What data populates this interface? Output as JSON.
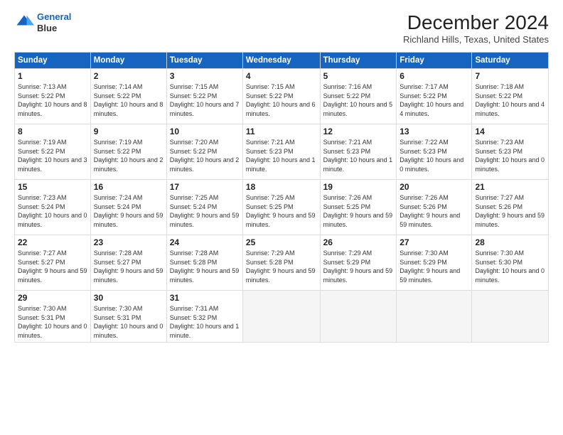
{
  "header": {
    "logo_line1": "General",
    "logo_line2": "Blue",
    "title": "December 2024",
    "subtitle": "Richland Hills, Texas, United States"
  },
  "calendar": {
    "days_of_week": [
      "Sunday",
      "Monday",
      "Tuesday",
      "Wednesday",
      "Thursday",
      "Friday",
      "Saturday"
    ],
    "weeks": [
      [
        {
          "num": "1",
          "rise": "7:13 AM",
          "set": "5:22 PM",
          "daylight": "10 hours and 8 minutes."
        },
        {
          "num": "2",
          "rise": "7:14 AM",
          "set": "5:22 PM",
          "daylight": "10 hours and 8 minutes."
        },
        {
          "num": "3",
          "rise": "7:15 AM",
          "set": "5:22 PM",
          "daylight": "10 hours and 7 minutes."
        },
        {
          "num": "4",
          "rise": "7:15 AM",
          "set": "5:22 PM",
          "daylight": "10 hours and 6 minutes."
        },
        {
          "num": "5",
          "rise": "7:16 AM",
          "set": "5:22 PM",
          "daylight": "10 hours and 5 minutes."
        },
        {
          "num": "6",
          "rise": "7:17 AM",
          "set": "5:22 PM",
          "daylight": "10 hours and 4 minutes."
        },
        {
          "num": "7",
          "rise": "7:18 AM",
          "set": "5:22 PM",
          "daylight": "10 hours and 4 minutes."
        }
      ],
      [
        {
          "num": "8",
          "rise": "7:19 AM",
          "set": "5:22 PM",
          "daylight": "10 hours and 3 minutes."
        },
        {
          "num": "9",
          "rise": "7:19 AM",
          "set": "5:22 PM",
          "daylight": "10 hours and 2 minutes."
        },
        {
          "num": "10",
          "rise": "7:20 AM",
          "set": "5:22 PM",
          "daylight": "10 hours and 2 minutes."
        },
        {
          "num": "11",
          "rise": "7:21 AM",
          "set": "5:23 PM",
          "daylight": "10 hours and 1 minute."
        },
        {
          "num": "12",
          "rise": "7:21 AM",
          "set": "5:23 PM",
          "daylight": "10 hours and 1 minute."
        },
        {
          "num": "13",
          "rise": "7:22 AM",
          "set": "5:23 PM",
          "daylight": "10 hours and 0 minutes."
        },
        {
          "num": "14",
          "rise": "7:23 AM",
          "set": "5:23 PM",
          "daylight": "10 hours and 0 minutes."
        }
      ],
      [
        {
          "num": "15",
          "rise": "7:23 AM",
          "set": "5:24 PM",
          "daylight": "10 hours and 0 minutes."
        },
        {
          "num": "16",
          "rise": "7:24 AM",
          "set": "5:24 PM",
          "daylight": "9 hours and 59 minutes."
        },
        {
          "num": "17",
          "rise": "7:25 AM",
          "set": "5:24 PM",
          "daylight": "9 hours and 59 minutes."
        },
        {
          "num": "18",
          "rise": "7:25 AM",
          "set": "5:25 PM",
          "daylight": "9 hours and 59 minutes."
        },
        {
          "num": "19",
          "rise": "7:26 AM",
          "set": "5:25 PM",
          "daylight": "9 hours and 59 minutes."
        },
        {
          "num": "20",
          "rise": "7:26 AM",
          "set": "5:26 PM",
          "daylight": "9 hours and 59 minutes."
        },
        {
          "num": "21",
          "rise": "7:27 AM",
          "set": "5:26 PM",
          "daylight": "9 hours and 59 minutes."
        }
      ],
      [
        {
          "num": "22",
          "rise": "7:27 AM",
          "set": "5:27 PM",
          "daylight": "9 hours and 59 minutes."
        },
        {
          "num": "23",
          "rise": "7:28 AM",
          "set": "5:27 PM",
          "daylight": "9 hours and 59 minutes."
        },
        {
          "num": "24",
          "rise": "7:28 AM",
          "set": "5:28 PM",
          "daylight": "9 hours and 59 minutes."
        },
        {
          "num": "25",
          "rise": "7:29 AM",
          "set": "5:28 PM",
          "daylight": "9 hours and 59 minutes."
        },
        {
          "num": "26",
          "rise": "7:29 AM",
          "set": "5:29 PM",
          "daylight": "9 hours and 59 minutes."
        },
        {
          "num": "27",
          "rise": "7:30 AM",
          "set": "5:29 PM",
          "daylight": "9 hours and 59 minutes."
        },
        {
          "num": "28",
          "rise": "7:30 AM",
          "set": "5:30 PM",
          "daylight": "10 hours and 0 minutes."
        }
      ],
      [
        {
          "num": "29",
          "rise": "7:30 AM",
          "set": "5:31 PM",
          "daylight": "10 hours and 0 minutes."
        },
        {
          "num": "30",
          "rise": "7:30 AM",
          "set": "5:31 PM",
          "daylight": "10 hours and 0 minutes."
        },
        {
          "num": "31",
          "rise": "7:31 AM",
          "set": "5:32 PM",
          "daylight": "10 hours and 1 minute."
        },
        null,
        null,
        null,
        null
      ]
    ]
  }
}
